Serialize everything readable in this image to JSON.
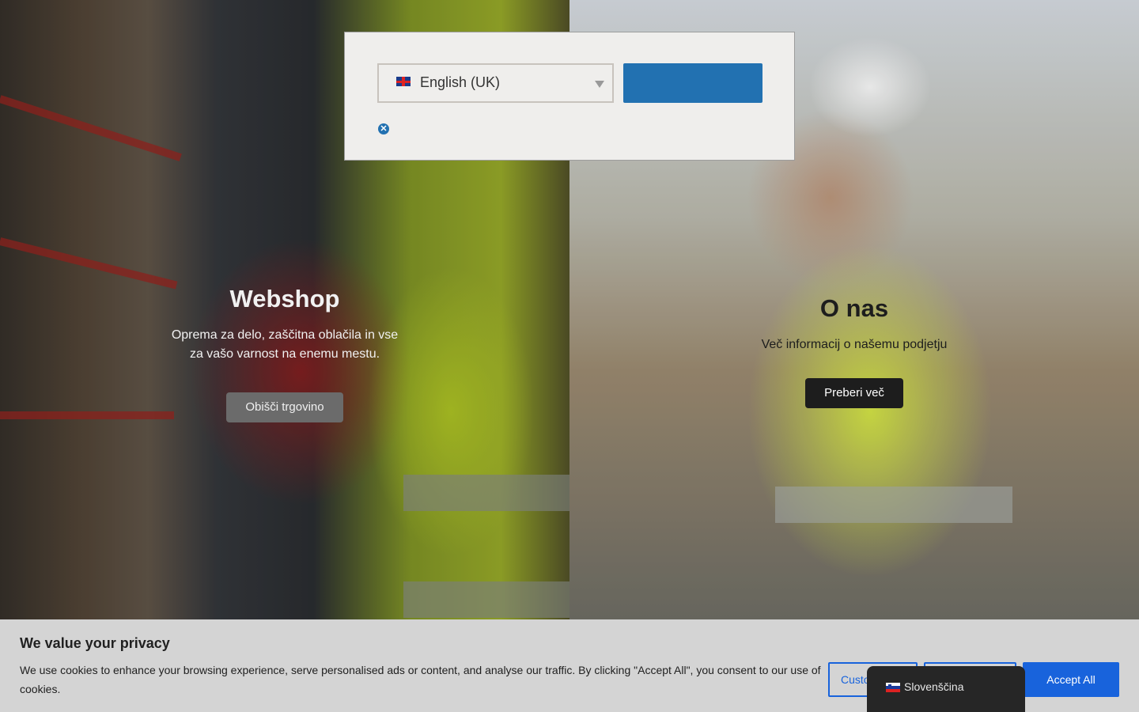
{
  "hero": {
    "webshop": {
      "title": "Webshop",
      "text": "Oprema za delo, zaščitna oblačila in vse za vašo varnost na enemu mestu.",
      "button": "Obišči trgovino"
    },
    "about": {
      "title": "O nas",
      "text": "Več informacij o našemu podjetju",
      "button": "Preberi več"
    }
  },
  "language_modal": {
    "selected_language": "English (UK)",
    "flag": "flag-uk-icon",
    "go_button_label": "",
    "close_icon": "close-icon"
  },
  "cookie_banner": {
    "title": "We value your privacy",
    "text": "We use cookies to enhance your browsing experience, serve personalised ads or content, and analyse our traffic. By clicking \"Accept All\", you consent to our use of cookies.",
    "customise_label": "Customise",
    "reject_label": "",
    "accept_label": "Accept All"
  },
  "language_switcher": {
    "current": "Slovenščina",
    "flag": "flag-si-icon"
  },
  "colors": {
    "primary_blue": "#1863dc",
    "modal_button_blue": "#2271b1",
    "banner_bg": "#d4d4d4",
    "switcher_bg": "#262626"
  }
}
